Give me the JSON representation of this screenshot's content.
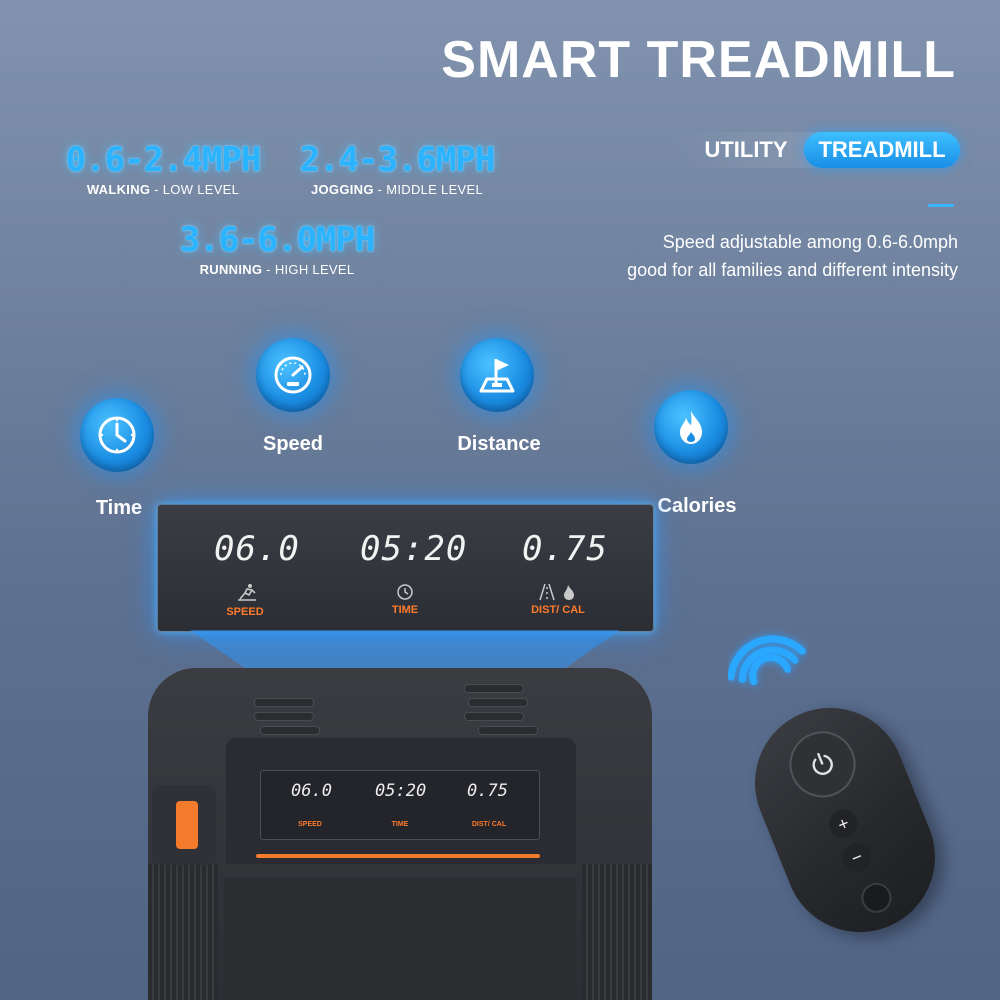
{
  "title": "SMART TREADMILL",
  "tabs": [
    {
      "label": "UTILITY",
      "active": false
    },
    {
      "label": "TREADMILL",
      "active": true
    }
  ],
  "description": [
    "Speed adjustable among 0.6-6.0mph",
    "good for all families and different intensity"
  ],
  "speed_ranges": [
    {
      "range": "0.6-2.4MPH",
      "mode": "WALKING",
      "level": "LOW LEVEL"
    },
    {
      "range": "2.4-3.6MPH",
      "mode": "JOGGING",
      "level": "MIDDLE LEVEL"
    },
    {
      "range": "3.6-6.0MPH",
      "mode": "RUNNING",
      "level": "HIGH LEVEL"
    }
  ],
  "features": [
    {
      "label": "Time",
      "icon": "clock-icon"
    },
    {
      "label": "Speed",
      "icon": "speedometer-icon"
    },
    {
      "label": "Distance",
      "icon": "flag-icon"
    },
    {
      "label": "Calories",
      "icon": "flame-icon"
    }
  ],
  "display": {
    "speed_value": "06.0",
    "time_value": "05:20",
    "dist_value": "0.75",
    "speed_label": "SPEED",
    "time_label": "TIME",
    "dist_label": "DIST/ CAL"
  },
  "remote": {
    "plus": "+",
    "minus": "−"
  },
  "colors": {
    "accent": "#2ab3ff",
    "orange": "#f07a2a",
    "console": "#2c2e33"
  }
}
